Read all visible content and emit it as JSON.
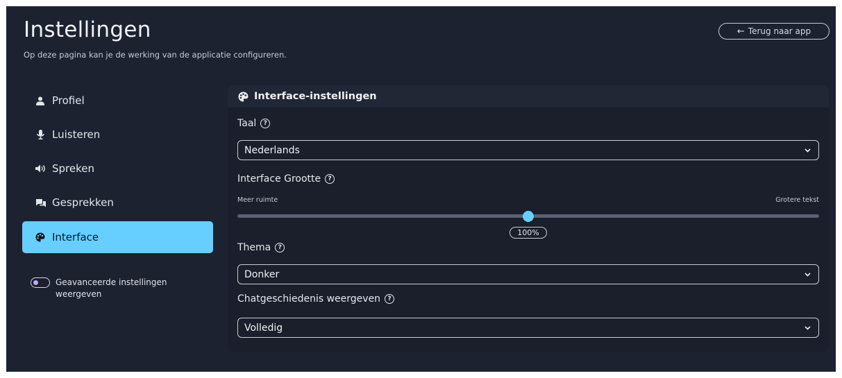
{
  "header": {
    "title": "Instellingen",
    "subtitle": "Op deze pagina kan je de werking van de applicatie configureren.",
    "back_label": "Terug naar app"
  },
  "sidebar": {
    "items": [
      {
        "label": "Profiel",
        "icon": "user-icon"
      },
      {
        "label": "Luisteren",
        "icon": "microphone-icon"
      },
      {
        "label": "Spreken",
        "icon": "speaker-icon"
      },
      {
        "label": "Gesprekken",
        "icon": "chat-bubbles-icon"
      },
      {
        "label": "Interface",
        "icon": "palette-icon",
        "active": true
      }
    ],
    "advanced_toggle": {
      "label": "Geavanceerde instellingen weergeven",
      "checked": false
    }
  },
  "panel": {
    "title": "Interface-instellingen",
    "language": {
      "label": "Taal",
      "value": "Nederlands"
    },
    "size": {
      "label": "Interface Grootte",
      "min_label": "Meer ruimte",
      "max_label": "Grotere tekst",
      "value": "100%",
      "position_fraction": 0.5
    },
    "theme": {
      "label": "Thema",
      "value": "Donker"
    },
    "history": {
      "label": "Chatgeschiedenis weergeven",
      "value": "Volledig"
    }
  },
  "colors": {
    "background": "#1d2230",
    "panel": "#1a1f2b",
    "accent": "#66cfff",
    "toggle_knob": "#c4a6ff"
  }
}
